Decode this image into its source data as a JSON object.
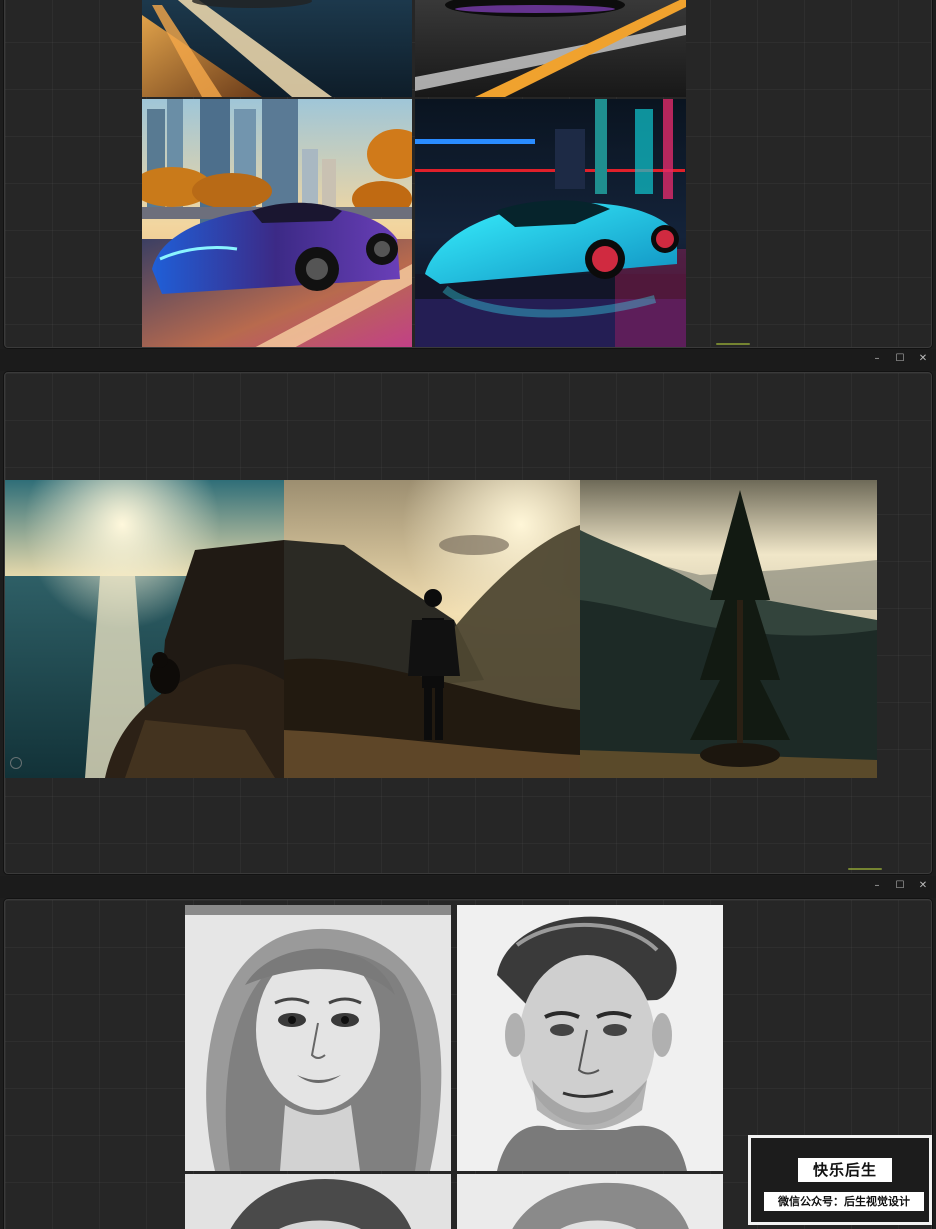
{
  "window_controls": {
    "minimize": "–",
    "maximize": "☐",
    "close": "✕"
  },
  "panels": [
    {
      "name": "car-renders",
      "images": [
        "sports-car-on-sunset-road",
        "sports-car-night-road",
        "blue-supercar-city-sunset",
        "cyan-neon-supercar-night"
      ]
    },
    {
      "name": "landscape-triptych",
      "images": [
        "girl-on-cliff-by-sea",
        "woman-on-mountain-ridge",
        "lone-pine-tree-forest"
      ]
    },
    {
      "name": "pencil-portraits",
      "images": [
        "woman-pencil-portrait",
        "man-pencil-portrait",
        "portrait-3-partial",
        "portrait-4-partial"
      ]
    }
  ],
  "watermark": {
    "title": "快乐后生",
    "subtitle": "微信公众号：后生视觉设计"
  },
  "colors": {
    "panel_bg": "#262626",
    "titlebar_bg": "#1b1b1b",
    "accent": "#b7d23a"
  }
}
